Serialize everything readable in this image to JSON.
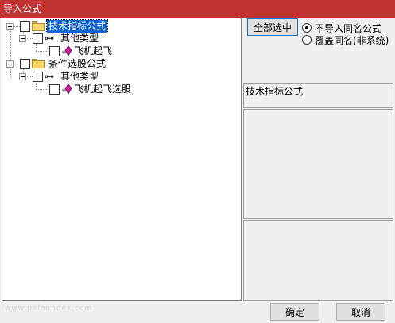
{
  "window": {
    "title": "导入公式"
  },
  "tree": {
    "items": [
      {
        "label": "技术指标公式",
        "selected": true
      },
      {
        "label": "其他类型"
      },
      {
        "label": "飞机起飞"
      },
      {
        "label": "条件选股公式"
      },
      {
        "label": "其他类型"
      },
      {
        "label": "飞机起飞选股"
      }
    ]
  },
  "controls": {
    "select_all_label": "全部选中",
    "radio_options": [
      {
        "label": "不导入同名公式",
        "checked": true
      },
      {
        "label": "覆盖同名(非系统)",
        "checked": false
      }
    ]
  },
  "preview": {
    "name": "技术指标公式"
  },
  "footer": {
    "ok_label": "确定",
    "cancel_label": "取消",
    "watermark": "www.palmindex.com"
  },
  "colors": {
    "titlebar": "#c33232",
    "selection": "#0a64d2"
  },
  "icons": [
    "folder-icon",
    "key-icon",
    "formula-gem-icon",
    "tree-expander-icon",
    "checkbox-icon"
  ]
}
